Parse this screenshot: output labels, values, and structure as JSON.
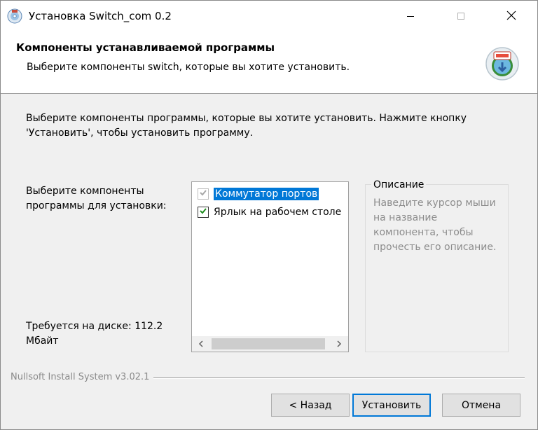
{
  "window": {
    "title": "Установка Switch_com 0.2",
    "app_icon": "installer-disc-icon"
  },
  "header": {
    "title": "Компоненты устанавливаемой программы",
    "subtitle": "Выберите компоненты switch, которые вы хотите установить.",
    "logo_icon": "nsis-installer-logo-icon"
  },
  "body": {
    "intro": "Выберите компоненты программы, которые вы хотите установить. Нажмите кнопку 'Установить', чтобы установить программу.",
    "select_label": "Выберите компоненты программы для установки:",
    "disk_label": "Требуется на диске: 112.2 Мбайт",
    "components": [
      {
        "label": "Коммутатор портов",
        "checked": true,
        "disabled": true,
        "selected": true
      },
      {
        "label": "Ярлык на рабочем столе",
        "checked": true,
        "disabled": false,
        "selected": false
      }
    ],
    "description": {
      "title": "Описание",
      "text": "Наведите курсор мыши на название компонента, чтобы прочесть его описание."
    }
  },
  "footer": {
    "branding": "Nullsoft Install System v3.02.1",
    "back_label": "< Назад",
    "install_label": "Установить",
    "cancel_label": "Отмена"
  },
  "colors": {
    "accent": "#0078d7",
    "check_green": "#1f8c1f",
    "disabled_check": "#a8a8a8"
  }
}
